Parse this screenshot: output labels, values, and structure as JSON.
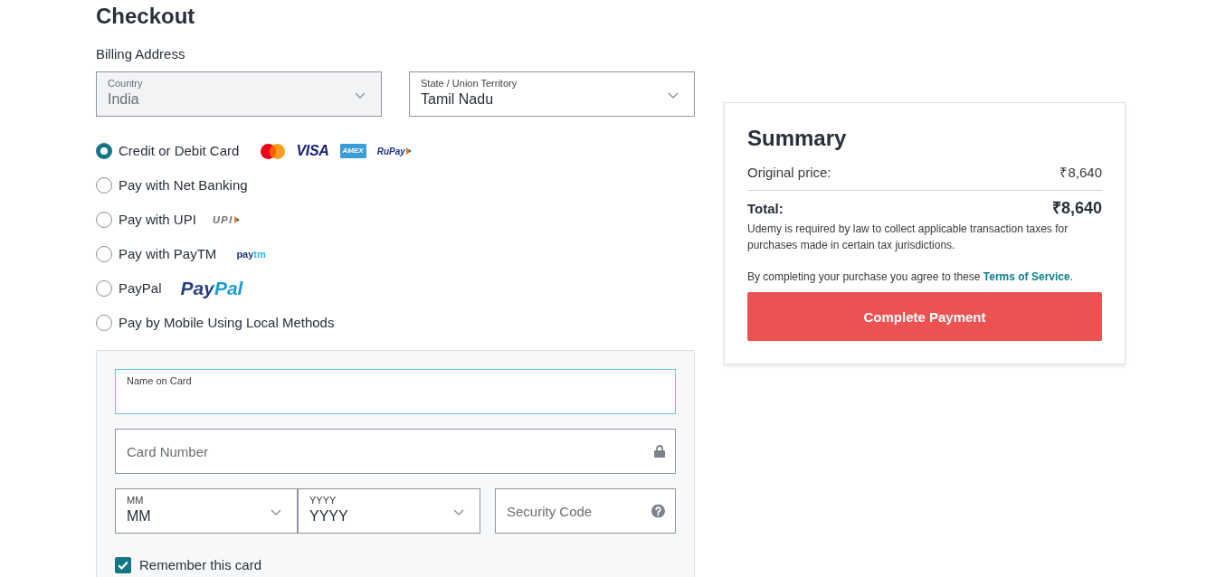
{
  "page": {
    "title": "Checkout"
  },
  "billing": {
    "heading": "Billing Address",
    "fields": [
      {
        "kind": "select",
        "label": "Country",
        "value": "India",
        "disabled": true
      },
      {
        "kind": "select",
        "label": "State / Union Territory",
        "value": "Tamil Nadu",
        "disabled": false
      }
    ]
  },
  "payment_methods": [
    {
      "label": "Credit or Debit Card",
      "selected": true,
      "logos": [
        {
          "kind": "circles"
        },
        {
          "kind": "visa",
          "text": "VISA"
        },
        {
          "kind": "amex",
          "text": "AMEX"
        },
        {
          "kind": "rupay",
          "text": "RuPay"
        }
      ]
    },
    {
      "label": "Pay with Net Banking",
      "selected": false
    },
    {
      "label": "Pay with UPI",
      "selected": false,
      "logos": [
        {
          "kind": "upi",
          "text": "UPI"
        }
      ]
    },
    {
      "label": "Pay with PayTM",
      "selected": false,
      "logos": [
        {
          "kind": "paytm",
          "text": "paytm"
        }
      ]
    },
    {
      "label": "PayPal",
      "selected": false,
      "logos": [
        {
          "kind": "paypal",
          "text": "PayPal"
        }
      ]
    },
    {
      "label": "Pay by Mobile Using Local Methods",
      "selected": false
    }
  ],
  "card_form": {
    "rows": [
      {
        "fields": [
          {
            "kind": "text",
            "label": "Name on Card",
            "focused": true
          }
        ]
      },
      {
        "fields": [
          {
            "kind": "secure",
            "placeholder": "Card Number",
            "focused": false
          }
        ]
      },
      {
        "fields": [
          {
            "kind": "select",
            "label": "MM",
            "value": "MM",
            "focused": false
          },
          {
            "kind": "select",
            "label": "YYYY",
            "value": "YYYY",
            "focused": false
          },
          {
            "kind": "help",
            "placeholder": "Security Code",
            "focused": false
          }
        ]
      }
    ],
    "remember": {
      "label": "Remember this card",
      "checked": true
    }
  },
  "summary": {
    "title": "Summary",
    "lines": [
      {
        "kind": "subtotal",
        "label": "Original price:",
        "amount": "₹8,640"
      },
      {
        "kind": "total",
        "label": "Total:",
        "amount": "₹8,640"
      }
    ],
    "tax_note": "Udemy is required by law to collect applicable transaction taxes for purchases made in certain tax jurisdictions.",
    "agreement": {
      "text": "By completing your purchase you agree to these",
      "link": "Terms of Service",
      "end": "."
    },
    "button": "Complete Payment"
  }
}
